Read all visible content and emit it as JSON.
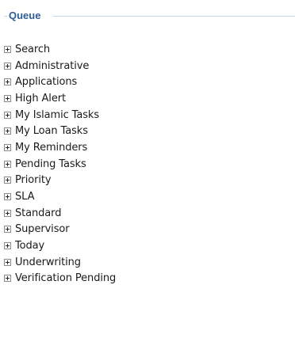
{
  "queue": {
    "title": "Queue",
    "items": [
      {
        "label": "Search",
        "expander_icon": "plus-box-icon"
      },
      {
        "label": "Administrative",
        "expander_icon": "plus-box-icon"
      },
      {
        "label": "Applications",
        "expander_icon": "plus-box-icon"
      },
      {
        "label": "High Alert",
        "expander_icon": "plus-box-icon"
      },
      {
        "label": "My Islamic Tasks",
        "expander_icon": "plus-box-icon"
      },
      {
        "label": "My Loan Tasks",
        "expander_icon": "plus-box-icon"
      },
      {
        "label": "My Reminders",
        "expander_icon": "plus-box-icon"
      },
      {
        "label": "Pending Tasks",
        "expander_icon": "plus-box-icon"
      },
      {
        "label": "Priority",
        "expander_icon": "plus-box-icon"
      },
      {
        "label": "SLA",
        "expander_icon": "plus-box-icon"
      },
      {
        "label": "Standard",
        "expander_icon": "plus-box-icon"
      },
      {
        "label": "Supervisor",
        "expander_icon": "plus-box-icon"
      },
      {
        "label": "Today",
        "expander_icon": "plus-box-icon"
      },
      {
        "label": "Underwriting",
        "expander_icon": "plus-box-icon"
      },
      {
        "label": "Verification Pending",
        "expander_icon": "plus-box-icon"
      }
    ]
  },
  "colors": {
    "title": "#2d5d99",
    "fieldset_border": "#c9d6e6",
    "item_text": "#1a1a1a",
    "expander_border": "#8a8a8a"
  }
}
